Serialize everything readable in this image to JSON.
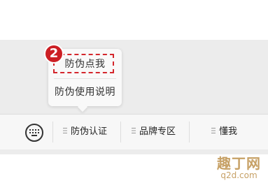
{
  "popup": {
    "items": [
      {
        "label": "防伪点我"
      },
      {
        "label": "防伪使用说明"
      }
    ]
  },
  "step_badge": "2",
  "menu_bar": {
    "keyboard_icon": "keyboard-icon",
    "items": [
      {
        "label": "防伪认证",
        "icon": "menu-list-icon"
      },
      {
        "label": "品牌专区",
        "icon": "menu-list-icon"
      },
      {
        "label": "懂我",
        "icon": "menu-list-icon"
      }
    ]
  },
  "watermark": {
    "title": "趣丁网",
    "domain": "q2d.com"
  },
  "colors": {
    "highlight": "#d4262c",
    "badge": "#cc1f24",
    "watermark": "#c7a166"
  }
}
